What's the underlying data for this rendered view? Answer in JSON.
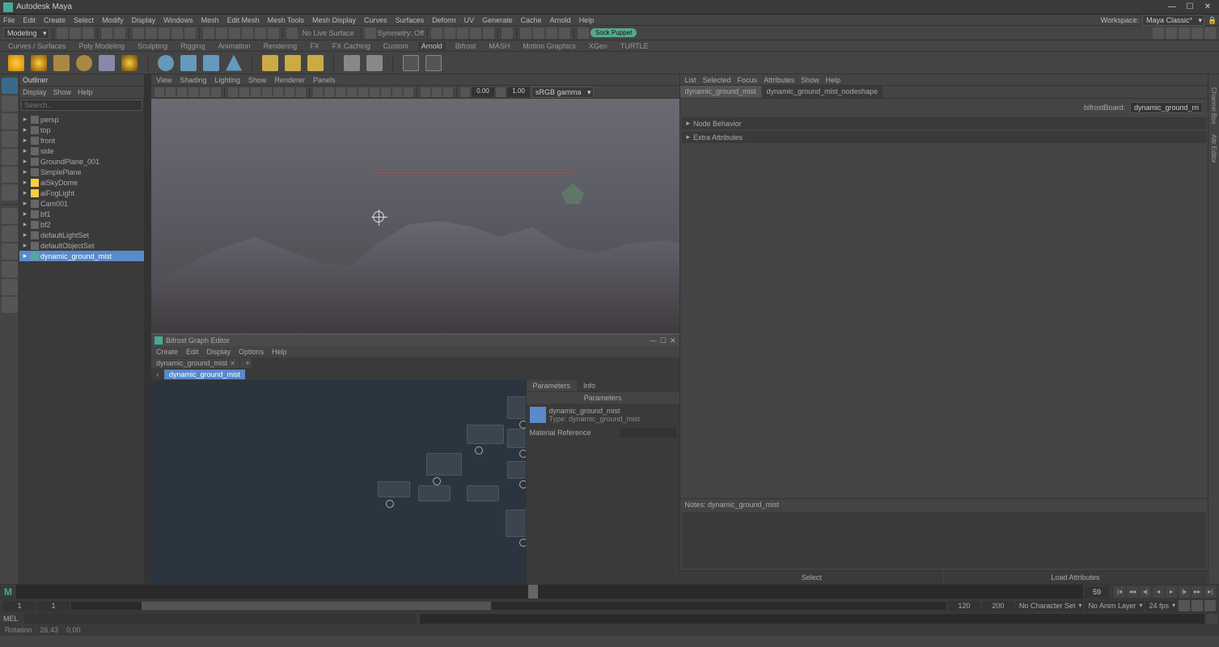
{
  "app": {
    "title": "Autodesk Maya"
  },
  "menus": [
    "File",
    "Edit",
    "Create",
    "Select",
    "Modify",
    "Display",
    "Windows",
    "Mesh",
    "Edit Mesh",
    "Mesh Tools",
    "Mesh Display",
    "Curves",
    "Surfaces",
    "Deform",
    "UV",
    "Generate",
    "Cache",
    "Arnold",
    "Help"
  ],
  "workspace": {
    "label": "Workspace:",
    "value": "Maya Classic*"
  },
  "status": {
    "mode": "Modeling",
    "livesurface": "No Live Surface",
    "symmetry": "Symmetry: Off",
    "svnpill": "Sock Puppet"
  },
  "shelftabs": [
    "Curves / Surfaces",
    "Poly Modeling",
    "Sculpting",
    "Rigging",
    "Animation",
    "Rendering",
    "FX",
    "FX Caching",
    "Custom",
    "Arnold",
    "Bifrost",
    "MASH",
    "Motion Graphics",
    "XGen",
    "TURTLE"
  ],
  "outliner": {
    "title": "Outliner",
    "menus": [
      "Display",
      "Show",
      "Help"
    ],
    "search_ph": "Search...",
    "items": [
      {
        "label": "persp"
      },
      {
        "label": "top"
      },
      {
        "label": "front"
      },
      {
        "label": "side"
      },
      {
        "label": "GroundPlane_001"
      },
      {
        "label": "SimplePlane"
      },
      {
        "label": "aiSkyDome"
      },
      {
        "label": "aiFogLight"
      },
      {
        "label": "Cam001"
      },
      {
        "label": "bf1"
      },
      {
        "label": "bf2"
      },
      {
        "label": "defaultLightSet"
      },
      {
        "label": "defaultObjectSet"
      },
      {
        "label": "dynamic_ground_mist",
        "sel": true
      }
    ]
  },
  "viewport": {
    "menus": [
      "View",
      "Shading",
      "Lighting",
      "Show",
      "Renderer",
      "Panels"
    ],
    "exposure": "0.00",
    "gamma": "1.00",
    "colormode": "sRGB gamma"
  },
  "bifrost": {
    "title": "Bifrost Graph Editor",
    "menus": [
      "Create",
      "Edit",
      "Display",
      "Options",
      "Help"
    ],
    "tab": "dynamic_ground_mist",
    "crumb": "dynamic_ground_mist",
    "params": {
      "tab1": "Parameters",
      "tab2": "Info",
      "heading": "Parameters",
      "nodeName": "dynamic_ground_mist",
      "nodeType": "Type: dynamic_ground_mist",
      "matref": "Material Reference"
    }
  },
  "attr": {
    "menus": [
      "List",
      "Selected",
      "Focus",
      "Attributes",
      "Show",
      "Help"
    ],
    "tab1": "dynamic_ground_mist",
    "tab2": "dynamic_ground_mist_nodeshape",
    "label": "bifrostBoard:",
    "value": "dynamic_ground_mist",
    "sect1": "Node Behavior",
    "sect2": "Extra Attributes",
    "notes": "Notes: dynamic_ground_mist",
    "btn1": "Select",
    "btn2": "Load Attributes"
  },
  "timeline": {
    "frame": "59",
    "start": "1",
    "startout": "1",
    "end": "120",
    "endout": "200",
    "charset": "No Character Set",
    "animlayer": "No Anim Layer",
    "fps": "24 fps"
  },
  "cmd": {
    "label": "MEL"
  },
  "help": {
    "l1": "Rotation",
    "l2": "26.43",
    "l3": "0.00"
  }
}
